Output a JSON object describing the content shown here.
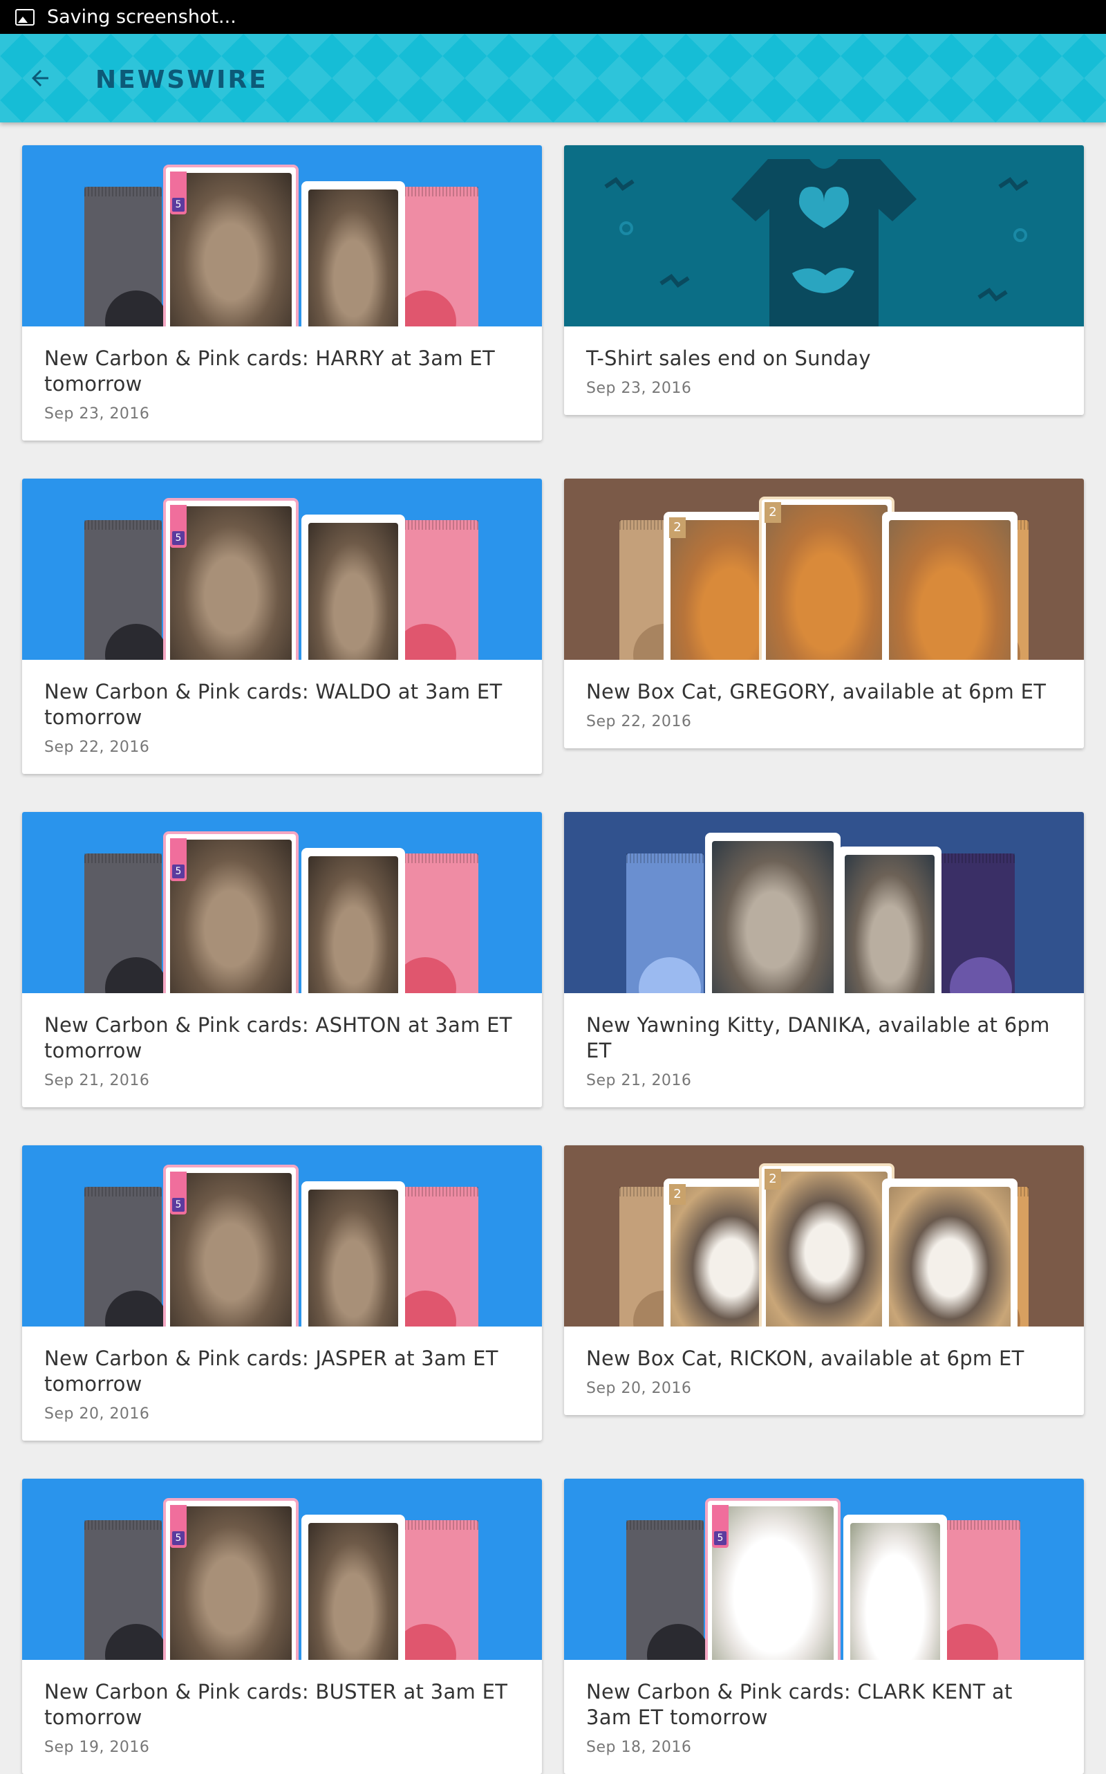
{
  "status_bar": {
    "text": "Saving screenshot...",
    "icon": "image-icon"
  },
  "app_bar": {
    "back_icon": "arrow-left-icon",
    "title": "NEWSWIRE",
    "color": "#16bdd6"
  },
  "news": [
    {
      "title": "New Carbon & Pink cards: HARRY at 3am ET tomorrow",
      "date": "Sep 23, 2016",
      "art": "carbon-pink",
      "vol": "5"
    },
    {
      "title": "T-Shirt sales end on Sunday",
      "date": "Sep 23, 2016",
      "art": "tshirt"
    },
    {
      "title": "New Carbon & Pink cards: WALDO at 3am ET tomorrow",
      "date": "Sep 22, 2016",
      "art": "carbon-pink",
      "vol": "5"
    },
    {
      "title": "New Box Cat, GREGORY, available at 6pm ET",
      "date": "Sep 22, 2016",
      "art": "boxcat",
      "num": "2"
    },
    {
      "title": "New Carbon & Pink cards: ASHTON at 3am ET tomorrow",
      "date": "Sep 21, 2016",
      "art": "carbon-pink",
      "vol": "5"
    },
    {
      "title": "New Yawning Kitty, DANIKA, available at 6pm ET",
      "date": "Sep 21, 2016",
      "art": "yawning"
    },
    {
      "title": "New Carbon & Pink cards: JASPER at 3am ET tomorrow",
      "date": "Sep 20, 2016",
      "art": "carbon-pink",
      "vol": "5"
    },
    {
      "title": "New Box Cat, RICKON, available at 6pm ET",
      "date": "Sep 20, 2016",
      "art": "boxcat",
      "num": "2"
    },
    {
      "title": "New Carbon & Pink cards: BUSTER at 3am ET tomorrow",
      "date": "Sep 19, 2016",
      "art": "carbon-pink",
      "vol": "5"
    },
    {
      "title": "New Carbon & Pink cards: CLARK KENT at 3am ET tomorrow",
      "date": "Sep 18, 2016",
      "art": "carbon-pink-white",
      "vol": "5"
    }
  ]
}
